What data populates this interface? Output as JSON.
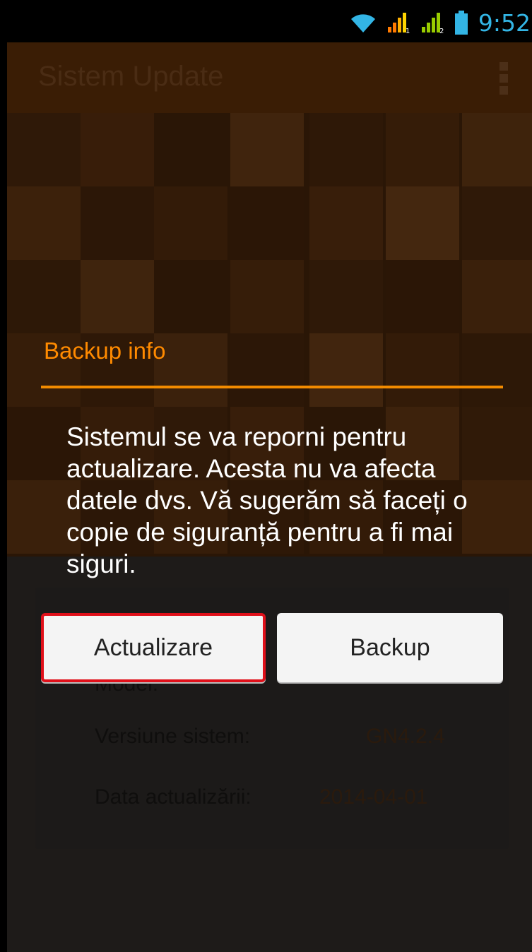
{
  "status_bar": {
    "time": "9:52",
    "icons": [
      "wifi-icon",
      "signal-sim1-icon",
      "signal-sim2-icon",
      "battery-icon"
    ]
  },
  "app": {
    "title": "Sistem Update",
    "info": {
      "model_label": "Model:",
      "system_version_label": "Versiune sistem:",
      "system_version_value": "GN4.2.4",
      "update_date_label": "Data actualizării:",
      "update_date_value": "2014-04-01"
    }
  },
  "dialog": {
    "title": "Backup info",
    "message": "Sistemul se va reporni pentru actualizare. Acesta nu va afecta datele dvs. Vă sugerăm să faceți o copie de siguranță pentru a fi mai siguri.",
    "buttons": {
      "update": "Actualizare",
      "backup": "Backup"
    }
  },
  "colors": {
    "accent": "#ff8a00",
    "highlight_border": "#e0101a",
    "status_text": "#33b5e5"
  }
}
